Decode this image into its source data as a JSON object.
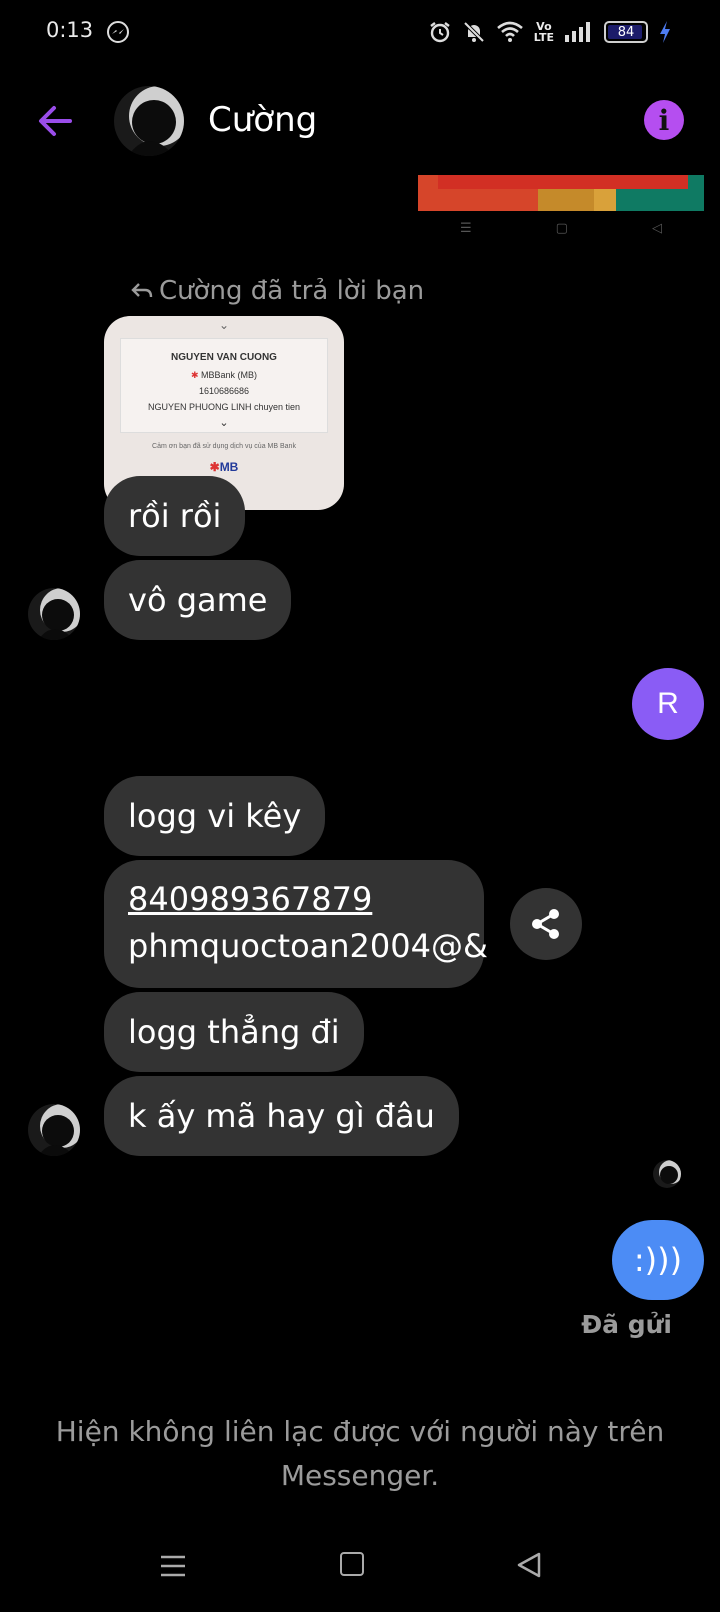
{
  "status_bar": {
    "time": "0:13",
    "battery": "84",
    "volte": "Vo\nLTE"
  },
  "header": {
    "contact_name": "Cường"
  },
  "thread": {
    "reply_label": "Cường đã trả lời bạn",
    "image_message": {
      "name": "NGUYEN VAN CUONG",
      "bank": "MBBank (MB)",
      "account": "1610686686",
      "note": "NGUYEN PHUONG LINH chuyen tien",
      "thanks": "Cảm ơn bạn đã sử dụng dịch vụ của MB Bank",
      "logo": "MB"
    },
    "msg1": "rồi rồi",
    "msg2": "vô game",
    "self_avatar_letter": "R",
    "msg3": "logg vi kêy",
    "msg4_link": "840989367879",
    "msg4_text": "phmquoctoan2004@&",
    "msg5": "logg thẳng đi",
    "msg6": "k ấy mã hay gì đâu",
    "sent_message": ":)))",
    "sent_status": "Đã gửi"
  },
  "notice": "Hiện không liên lạc được với người này trên Messenger.",
  "colors": {
    "accent": "#9a4dea",
    "bubble_gray": "#333333",
    "sent_blue": "#4c8cf5",
    "avatar_purple": "#8a5cf5"
  }
}
